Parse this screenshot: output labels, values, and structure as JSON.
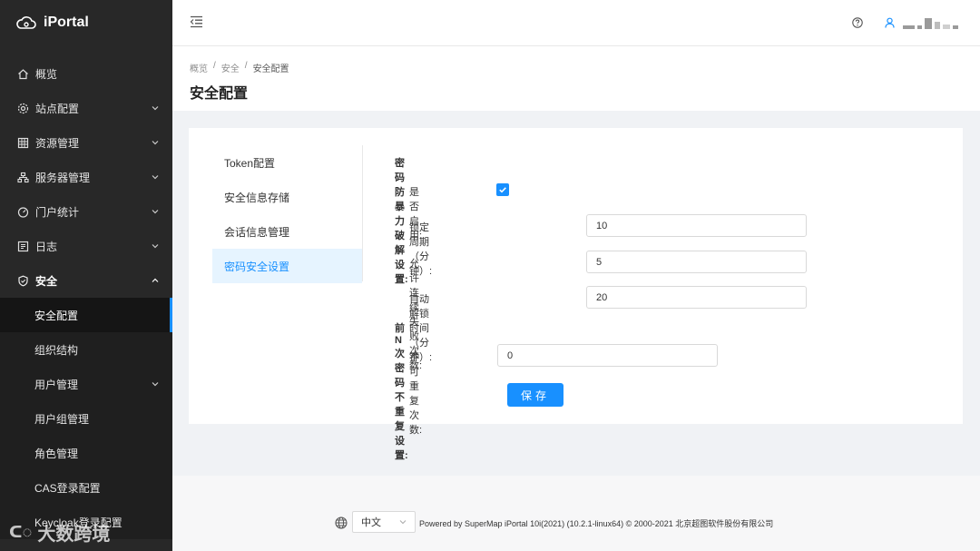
{
  "app": {
    "name": "iPortal"
  },
  "sidebar": {
    "items": [
      {
        "label": "概览",
        "icon": "home-icon",
        "expandable": false
      },
      {
        "label": "站点配置",
        "icon": "gear-icon",
        "expandable": true
      },
      {
        "label": "资源管理",
        "icon": "grid-icon",
        "expandable": true
      },
      {
        "label": "服务器管理",
        "icon": "server-icon",
        "expandable": true
      },
      {
        "label": "门户统计",
        "icon": "dashboard-icon",
        "expandable": true
      },
      {
        "label": "日志",
        "icon": "log-icon",
        "expandable": true
      },
      {
        "label": "安全",
        "icon": "shield-icon",
        "expandable": true,
        "open": true
      }
    ],
    "security_sub": [
      {
        "label": "安全配置",
        "active": true
      },
      {
        "label": "组织结构"
      },
      {
        "label": "用户管理",
        "expandable": true
      },
      {
        "label": "用户组管理"
      },
      {
        "label": "角色管理"
      },
      {
        "label": "CAS登录配置"
      },
      {
        "label": "Keycloak登录配置"
      }
    ]
  },
  "header": {
    "help_icon": "question-circle-icon",
    "user_icon": "user-icon"
  },
  "breadcrumb": {
    "items": [
      "概览",
      "安全",
      "安全配置"
    ],
    "separator": "/"
  },
  "page": {
    "title": "安全配置"
  },
  "tabs": [
    "Token配置",
    "安全信息存储",
    "会话信息管理",
    "密码安全设置"
  ],
  "active_tab": 3,
  "form": {
    "brute_force_title": "密码防暴力破解设置:",
    "enable_label": "是否启用:",
    "enabled": true,
    "lock_period_label": "锁定周期（分钟）:",
    "lock_period_value": "10",
    "allowed_failures_label": "允许连续失败次数:",
    "allowed_failures_value": "5",
    "auto_unlock_label": "自动解锁时间（分钟）:",
    "auto_unlock_value": "20",
    "no_repeat_title": "前N次密码不重复设置:",
    "no_repeat_label": "不可重复次数:",
    "no_repeat_value": "0",
    "save_label": "保存"
  },
  "footer": {
    "language": "中文",
    "copyright": "Powered by SuperMap iPortal 10i(2021) (10.2.1-linux64) © 2000-2021 北京超图软件股份有限公司"
  },
  "watermark": {
    "text": "大数跨境"
  },
  "colors": {
    "sidebar_bg": "#282828",
    "accent": "#1890ff",
    "active_tab_bg": "#e6f4ff"
  }
}
